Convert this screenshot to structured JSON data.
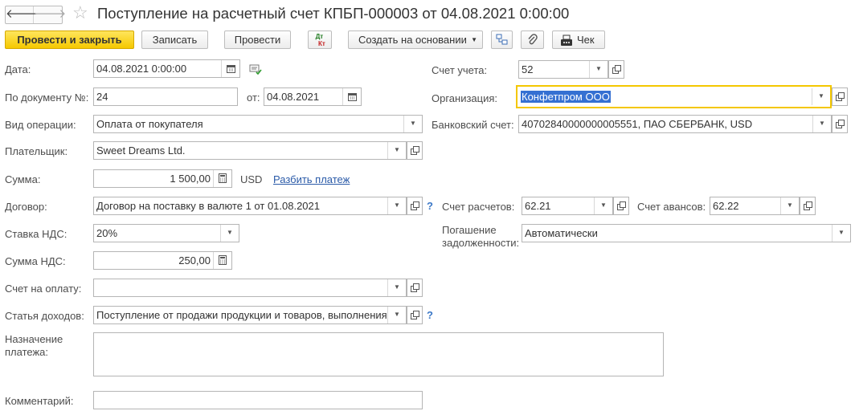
{
  "header": {
    "back_icon": "arrow-left-icon",
    "forward_icon": "arrow-right-icon",
    "favorite_icon": "star-icon",
    "title": "Поступление на расчетный счет КПБП-000003 от 04.08.2021 0:00:00"
  },
  "toolbar": {
    "post_and_close": "Провести и закрыть",
    "save": "Записать",
    "post": "Провести",
    "dt_kt_top": "Дт",
    "dt_kt_bottom": "Кт",
    "create_based_on": "Создать на основании",
    "structure_icon": "document-structure-icon",
    "attach_icon": "paperclip-icon",
    "receipt": "Чек"
  },
  "form": {
    "date_label": "Дата:",
    "date_value": "04.08.2021  0:00:00",
    "doc_number_label": "По документу №:",
    "doc_number_value": "24",
    "doc_from_label": "от:",
    "doc_from_value": "04.08.2021",
    "operation_type_label": "Вид операции:",
    "operation_type_value": "Оплата от покупателя",
    "payer_label": "Плательщик:",
    "payer_value": "Sweet Dreams Ltd.",
    "amount_label": "Сумма:",
    "amount_value": "1 500,00",
    "currency": "USD",
    "split_payment_link": "Разбить платеж",
    "contract_label": "Договор:",
    "contract_value": "Договор на поставку в валюте 1 от 01.08.2021",
    "help_mark": "?",
    "vat_rate_label": "Ставка НДС:",
    "vat_rate_value": "20%",
    "vat_amount_label": "Сумма НДС:",
    "vat_amount_value": "250,00",
    "invoice_label": "Счет на оплату:",
    "invoice_value": "",
    "income_item_label": "Статья доходов:",
    "income_item_value": "Поступление от продажи продукции и товаров, выполнения",
    "purpose_label": "Назначение платежа:",
    "purpose_value": "",
    "comment_label": "Комментарий:",
    "comment_value": "",
    "account_label": "Счет учета:",
    "account_value": "52",
    "organization_label": "Организация:",
    "organization_value": "Конфетпром ООО",
    "bank_account_label": "Банковский счет:",
    "bank_account_value": "40702840000000005551, ПАО СБЕРБАНК, USD",
    "settlement_account_label": "Счет расчетов:",
    "settlement_account_value": "62.21",
    "advance_account_label": "Счет авансов:",
    "advance_account_value": "62.22",
    "debt_repayment_label": "Погашение задолженности:",
    "debt_repayment_value": "Автоматически"
  }
}
